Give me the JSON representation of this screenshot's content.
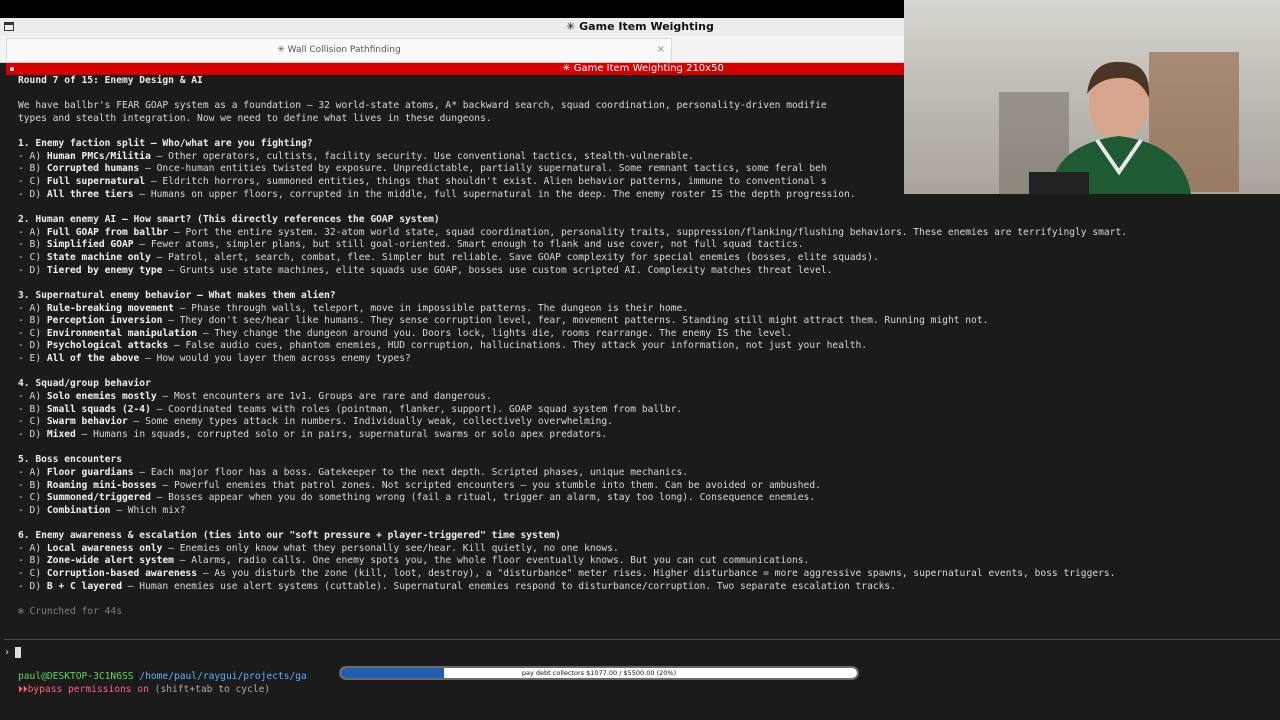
{
  "window": {
    "title": "✳ Game Item Weighting"
  },
  "tabs": [
    {
      "label": "✳ Wall Collision Pathfinding",
      "close": "×"
    }
  ],
  "pane": {
    "title": "✳ Game Item Weighting 210x50",
    "marker": "▪"
  },
  "colors": {
    "pane_title_bg": "#d40000",
    "user_host": "#5fd75f",
    "path": "#5fafff",
    "permission_warning": "#ff5f87",
    "progress_fill": "#1f5fae"
  },
  "terminal": {
    "lines": [
      {
        "style": "heading",
        "parts": [
          {
            "text": "Round 7 of 15: Enemy Design & AI"
          }
        ]
      },
      {
        "style": "blank"
      },
      {
        "parts": [
          {
            "text": "We have ballbr's FEAR GOAP system as a foundation — 32 world-state atoms, A* backward search, squad coordination, personality-driven modifie"
          }
        ]
      },
      {
        "parts": [
          {
            "text": "types and stealth integration. Now we need to define what lives in these dungeons."
          }
        ]
      },
      {
        "style": "blank"
      },
      {
        "style": "heading",
        "parts": [
          {
            "text": "1. Enemy faction split — Who/what are you fighting?"
          }
        ]
      },
      {
        "parts": [
          {
            "text": "- A) "
          },
          {
            "text": "Human PMCs/Militia",
            "key": true
          },
          {
            "text": " — Other operators, cultists, facility security. Use conventional tactics, stealth-vulnerable."
          }
        ]
      },
      {
        "parts": [
          {
            "text": "- B) "
          },
          {
            "text": "Corrupted humans",
            "key": true
          },
          {
            "text": " — Once-human entities twisted by exposure. Unpredictable, partially supernatural. Some remnant tactics, some feral beh"
          }
        ]
      },
      {
        "parts": [
          {
            "text": "- C) "
          },
          {
            "text": "Full supernatural",
            "key": true
          },
          {
            "text": " — Eldritch horrors, summoned entities, things that shouldn't exist. Alien behavior patterns, immune to conventional s"
          }
        ]
      },
      {
        "parts": [
          {
            "text": "- D) "
          },
          {
            "text": "All three tiers",
            "key": true
          },
          {
            "text": " — Humans on upper floors, corrupted in the middle, full supernatural in the deep. The enemy roster IS the depth progression."
          }
        ]
      },
      {
        "style": "blank"
      },
      {
        "style": "heading",
        "parts": [
          {
            "text": "2. Human enemy AI — How smart? (This directly references the GOAP system)"
          }
        ]
      },
      {
        "parts": [
          {
            "text": "- A) "
          },
          {
            "text": "Full GOAP from ballbr",
            "key": true
          },
          {
            "text": " — Port the entire system. 32-atom world state, squad coordination, personality traits, suppression/flanking/flushing behaviors. These enemies are terrifyingly smart."
          }
        ]
      },
      {
        "parts": [
          {
            "text": "- B) "
          },
          {
            "text": "Simplified GOAP",
            "key": true
          },
          {
            "text": " — Fewer atoms, simpler plans, but still goal-oriented. Smart enough to flank and use cover, not full squad tactics."
          }
        ]
      },
      {
        "parts": [
          {
            "text": "- C) "
          },
          {
            "text": "State machine only",
            "key": true
          },
          {
            "text": " — Patrol, alert, search, combat, flee. Simpler but reliable. Save GOAP complexity for special enemies (bosses, elite squads)."
          }
        ]
      },
      {
        "parts": [
          {
            "text": "- D) "
          },
          {
            "text": "Tiered by enemy type",
            "key": true
          },
          {
            "text": " — Grunts use state machines, elite squads use GOAP, bosses use custom scripted AI. Complexity matches threat level."
          }
        ]
      },
      {
        "style": "blank"
      },
      {
        "style": "heading",
        "parts": [
          {
            "text": "3. Supernatural enemy behavior — What makes them alien?"
          }
        ]
      },
      {
        "parts": [
          {
            "text": "- A) "
          },
          {
            "text": "Rule-breaking movement",
            "key": true
          },
          {
            "text": " — Phase through walls, teleport, move in impossible patterns. The dungeon is their home."
          }
        ]
      },
      {
        "parts": [
          {
            "text": "- B) "
          },
          {
            "text": "Perception inversion",
            "key": true
          },
          {
            "text": " — They don't see/hear like humans. They sense corruption level, fear, movement patterns. Standing still might attract them. Running might not."
          }
        ]
      },
      {
        "parts": [
          {
            "text": "- C) "
          },
          {
            "text": "Environmental manipulation",
            "key": true
          },
          {
            "text": " — They change the dungeon around you. Doors lock, lights die, rooms rearrange. The enemy IS the level."
          }
        ]
      },
      {
        "parts": [
          {
            "text": "- D) "
          },
          {
            "text": "Psychological attacks",
            "key": true
          },
          {
            "text": " — False audio cues, phantom enemies, HUD corruption, hallucinations. They attack your information, not just your health."
          }
        ]
      },
      {
        "parts": [
          {
            "text": "- E) "
          },
          {
            "text": "All of the above",
            "key": true
          },
          {
            "text": " — How would you layer them across enemy types?"
          }
        ]
      },
      {
        "style": "blank"
      },
      {
        "style": "heading",
        "parts": [
          {
            "text": "4. Squad/group behavior"
          }
        ]
      },
      {
        "parts": [
          {
            "text": "- A) "
          },
          {
            "text": "Solo enemies mostly",
            "key": true
          },
          {
            "text": " — Most encounters are 1v1. Groups are rare and dangerous."
          }
        ]
      },
      {
        "parts": [
          {
            "text": "- B) "
          },
          {
            "text": "Small squads (2-4)",
            "key": true
          },
          {
            "text": " — Coordinated teams with roles (pointman, flanker, support). GOAP squad system from ballbr."
          }
        ]
      },
      {
        "parts": [
          {
            "text": "- C) "
          },
          {
            "text": "Swarm behavior",
            "key": true
          },
          {
            "text": " — Some enemy types attack in numbers. Individually weak, collectively overwhelming."
          }
        ]
      },
      {
        "parts": [
          {
            "text": "- D) "
          },
          {
            "text": "Mixed",
            "key": true
          },
          {
            "text": " — Humans in squads, corrupted solo or in pairs, supernatural swarms or solo apex predators."
          }
        ]
      },
      {
        "style": "blank"
      },
      {
        "style": "heading",
        "parts": [
          {
            "text": "5. Boss encounters"
          }
        ]
      },
      {
        "parts": [
          {
            "text": "- A) "
          },
          {
            "text": "Floor guardians",
            "key": true
          },
          {
            "text": " — Each major floor has a boss. Gatekeeper to the next depth. Scripted phases, unique mechanics."
          }
        ]
      },
      {
        "parts": [
          {
            "text": "- B) "
          },
          {
            "text": "Roaming mini-bosses",
            "key": true
          },
          {
            "text": " — Powerful enemies that patrol zones. Not scripted encounters — you stumble into them. Can be avoided or ambushed."
          }
        ]
      },
      {
        "parts": [
          {
            "text": "- C) "
          },
          {
            "text": "Summoned/triggered",
            "key": true
          },
          {
            "text": " — Bosses appear when you do something wrong (fail a ritual, trigger an alarm, stay too long). Consequence enemies."
          }
        ]
      },
      {
        "parts": [
          {
            "text": "- D) "
          },
          {
            "text": "Combination",
            "key": true
          },
          {
            "text": " — Which mix?"
          }
        ]
      },
      {
        "style": "blank"
      },
      {
        "style": "heading",
        "parts": [
          {
            "text": "6. Enemy awareness & escalation (ties into our \"soft pressure + player-triggered\" time system)"
          }
        ]
      },
      {
        "parts": [
          {
            "text": "- A) "
          },
          {
            "text": "Local awareness only",
            "key": true
          },
          {
            "text": " — Enemies only know what they personally see/hear. Kill quietly, no one knows."
          }
        ]
      },
      {
        "parts": [
          {
            "text": "- B) "
          },
          {
            "text": "Zone-wide alert system",
            "key": true
          },
          {
            "text": " — Alarms, radio calls. One enemy spots you, the whole floor eventually knows. But you can cut communications."
          }
        ]
      },
      {
        "parts": [
          {
            "text": "- C) "
          },
          {
            "text": "Corruption-based awareness",
            "key": true
          },
          {
            "text": " — As you disturb the zone (kill, loot, destroy), a \"disturbance\" meter rises. Higher disturbance = more aggressive spawns, supernatural events, boss triggers."
          }
        ]
      },
      {
        "parts": [
          {
            "text": "- D) "
          },
          {
            "text": "B + C layered",
            "key": true
          },
          {
            "text": " — Human enemies use alert systems (cuttable). Supernatural enemies respond to disturbance/corruption. Two separate escalation tracks."
          }
        ]
      },
      {
        "style": "blank"
      },
      {
        "style": "dim",
        "parts": [
          {
            "text": "✻ Crunched for 44s"
          }
        ]
      }
    ]
  },
  "prompt": {
    "symbol": "›"
  },
  "status": {
    "user_host": "paul@DESKTOP-3C1N6SS",
    "separator": ":",
    "path": "/home/paul/raygui/projects/ga",
    "permission_icon": "⏵⏵",
    "permission_state": "bypass permissions on",
    "permission_hint": " (shift+tab to cycle)"
  },
  "progress": {
    "label": "pay debt collectors $1077.00 / $5500.00 (20%)",
    "fraction": 0.2
  }
}
